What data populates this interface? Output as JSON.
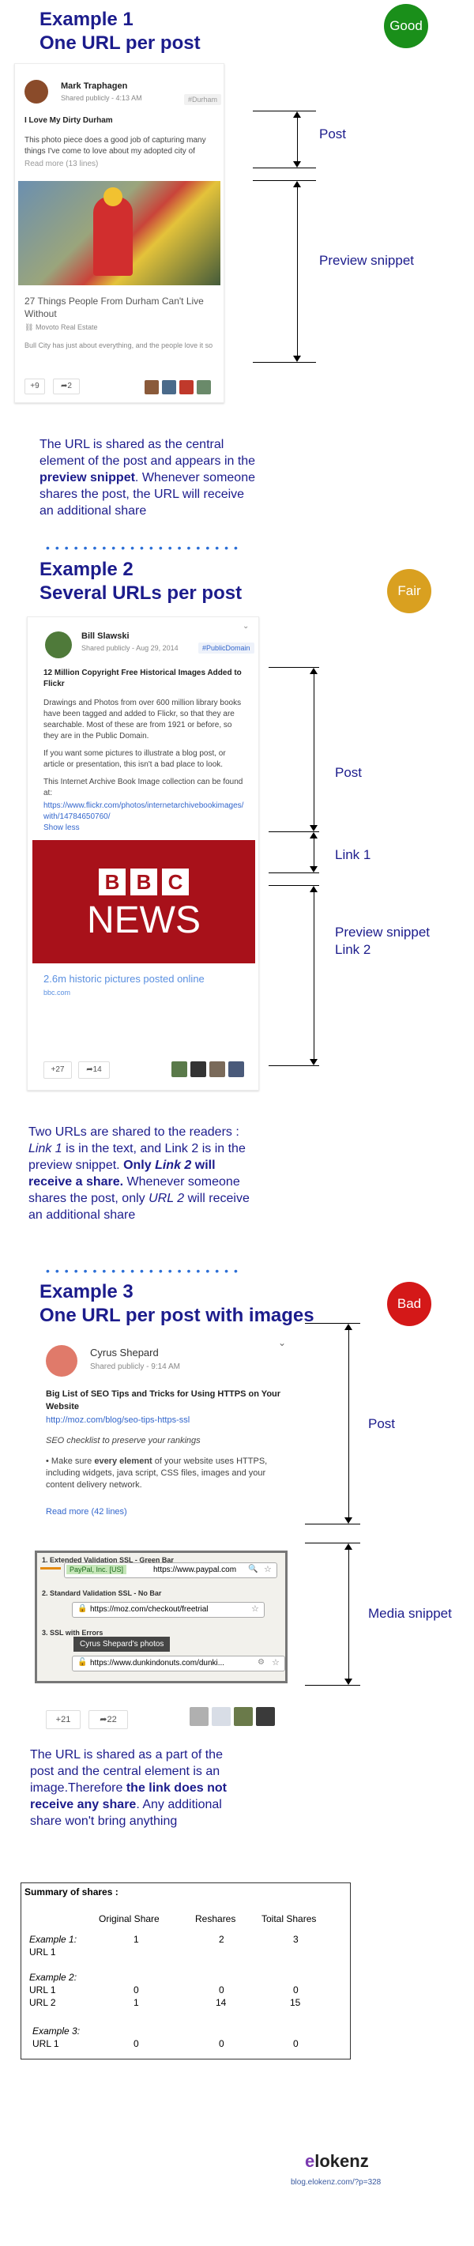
{
  "ex1": {
    "title_line1": "Example 1",
    "title_line2": "One URL per post",
    "badge": "Good",
    "badge_color": "#1a8f1a",
    "author": "Mark Traphagen",
    "shared": "Shared publicly",
    "time": "4:13 AM",
    "tag": "#Durham",
    "post_title": "I Love My Dirty Durham",
    "post_text": "This photo piece does a good job of capturing many things I've come to love about my adopted city of",
    "read_more": "Read more (13 lines)",
    "preview_title": "27 Things People From Durham Can't Live Without",
    "preview_source": "Movoto Real Estate",
    "preview_desc": "Bull City has just about everything, and the people love it so",
    "plus_count": "+9",
    "share_count": "2",
    "label_post": "Post",
    "label_preview": "Preview snippet",
    "desc_1": "The URL is shared as the central element of the post and appears in the ",
    "desc_bold": "preview snippet",
    "desc_2": ". Whenever someone shares the post, the URL will receive an additional share"
  },
  "ex2": {
    "title_line1": "Example 2",
    "title_line2": "Several  URLs per post",
    "badge": "Fair",
    "badge_color": "#d9a020",
    "author": "Bill Slawski",
    "shared": "Shared publicly",
    "time": "Aug 29, 2014",
    "tag": "#PublicDomain",
    "post_title": "12 Million Copyright Free Historical Images Added to Flickr",
    "post_text_1": "Drawings and Photos from over 600 million library books have been tagged and added to Flickr, so that they are searchable. Most of these are from 1921 or before, so they are in the Public Domain.",
    "post_text_2": "If you want some pictures to illustrate a blog post, or article or presentation, this isn't a bad place to look.",
    "post_text_3": "This Internet Archive Book Image collection can be found at:",
    "link_text": "https://www.flickr.com/photos/internetarchivebookimages/with/14784650760/",
    "show_less": "Show less",
    "bbc_letters": [
      "B",
      "B",
      "C"
    ],
    "news": "NEWS",
    "bbc_color": "#a8111a",
    "preview_title": "2.6m historic pictures posted online",
    "preview_source": "bbc.com",
    "plus_count": "+27",
    "share_count": "14",
    "label_post": "Post",
    "label_link1": "Link 1",
    "label_preview": "Preview snippet",
    "label_link2": "Link 2",
    "desc_1": "Two URLs are shared to the readers : ",
    "desc_link1": "Link 1",
    "desc_2": " is in the text, and Link 2 is in the preview snippet. ",
    "desc_bold_a": "Only ",
    "desc_bold_link2": "Link 2",
    "desc_bold_b": " will receive a share.",
    "desc_3": " Whenever someone shares the post, only ",
    "desc_url2": "URL 2",
    "desc_4": " will receive an additional share"
  },
  "ex3": {
    "title_line1": "Example 3",
    "title_line2": "One URL per post with images",
    "badge": "Bad",
    "badge_color": "#d41818",
    "author": "Cyrus Shepard",
    "shared": "Shared publicly",
    "time": "9:14 AM",
    "post_title": "Big List of SEO Tips and Tricks for Using HTTPS on Your Website",
    "link_text": "http://moz.com/blog/seo-tips-https-ssl",
    "italic_text": "SEO checklist to preserve your rankings",
    "post_text_a": "• Make sure ",
    "post_text_bold": "every element",
    "post_text_b": " of your website uses HTTPS, including widgets, java script, CSS files, images and your content delivery network.",
    "read_more": "Read more (42 lines)",
    "ssl_1": "1. Extended Validation SSL - Green Bar",
    "ssl_1_badge": "PayPal, Inc. [US]",
    "ssl_1_url": "https://www.paypal.com",
    "ssl_2": "2. Standard Validation SSL - No Bar",
    "ssl_2_url": "https://moz.com/checkout/freetrial",
    "ssl_3": "3. SSL with Errors",
    "ssl_3_url": "https://www.dunkindonuts.com/dunki...",
    "photo_caption": "Cyrus Shepard's photos",
    "plus_count": "+21",
    "share_count": "22",
    "label_post": "Post",
    "label_media": "Media snippet",
    "desc_1": "The URL is shared as a part of the post and the central element is an image.Therefore ",
    "desc_bold": "the link does not receive any share",
    "desc_2": ". Any additional share won't bring anything"
  },
  "summary": {
    "title": "Summary of shares :",
    "col_original": "Original Share",
    "col_reshares": "Reshares",
    "col_total": "Toital Shares",
    "ex1_label": "Example 1:",
    "ex1_url1": "URL 1",
    "ex1_vals": [
      "1",
      "2",
      "3"
    ],
    "ex2_label": "Example 2:",
    "ex2_url1": "URL 1",
    "ex2_url1_vals": [
      "0",
      "0",
      "0"
    ],
    "ex2_url2": "URL 2",
    "ex2_url2_vals": [
      "1",
      "14",
      "15"
    ],
    "ex3_label": "Example 3:",
    "ex3_url1": "URL 1",
    "ex3_vals": [
      "0",
      "0",
      "0"
    ]
  },
  "footer": {
    "logo_e": "e",
    "logo_rest": "lokenz",
    "url": "blog.elokenz.com/?p=328"
  }
}
